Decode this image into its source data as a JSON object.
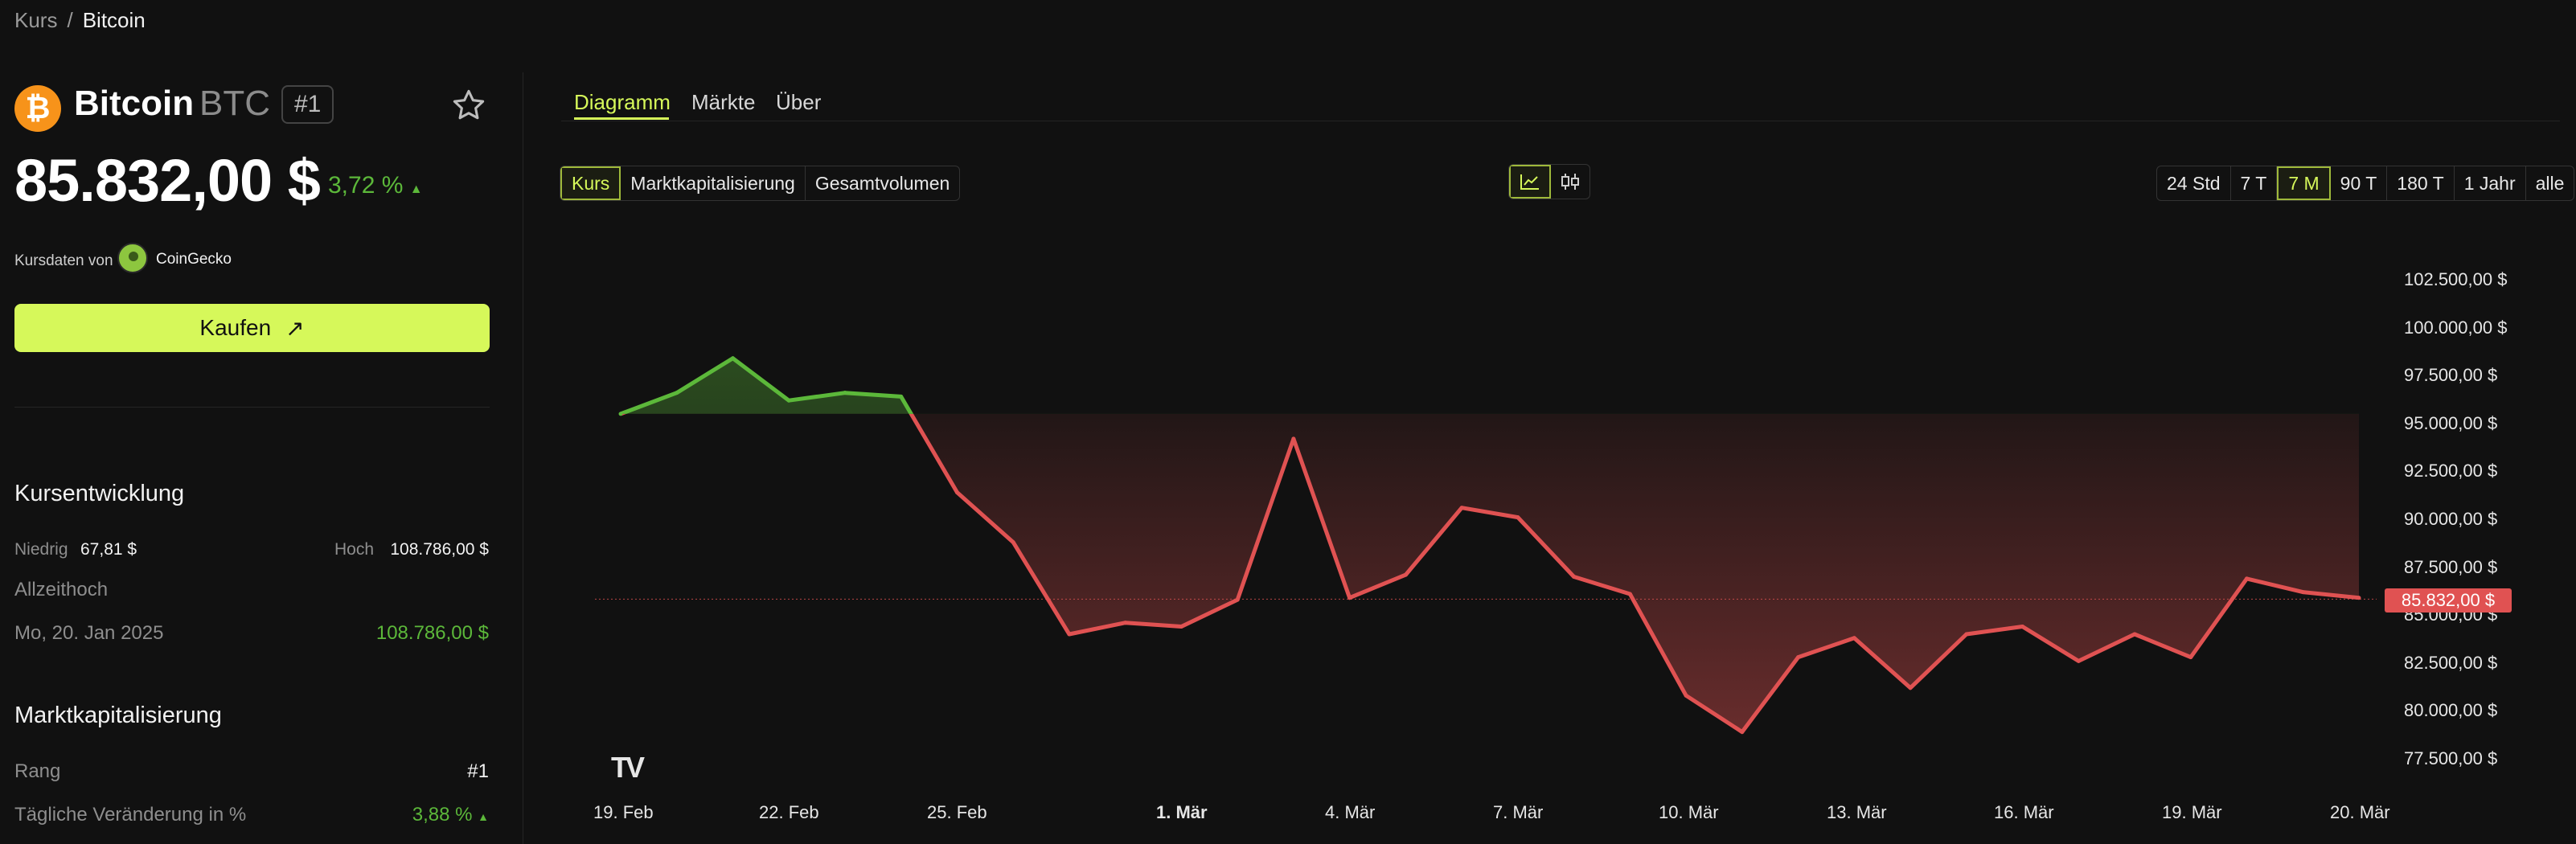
{
  "breadcrumb": {
    "parent": "Kurs",
    "separator": "/",
    "current": "Bitcoin"
  },
  "coin": {
    "name": "Bitcoin",
    "symbol": "BTC",
    "rank_badge": "#1",
    "price": "85.832,00 $",
    "change_24h": "3,72 %",
    "change_arrow": "▲",
    "source_label": "Kursdaten von",
    "source_name": "CoinGecko",
    "buy_label": "Kaufen",
    "buy_arrow": "↗"
  },
  "kursentwicklung": {
    "title": "Kursentwicklung",
    "low_label": "Niedrig",
    "low_value": "67,81 $",
    "high_label": "Hoch",
    "high_value": "108.786,00 $",
    "ath_label": "Allzeithoch",
    "ath_date": "Mo, 20. Jan 2025",
    "ath_value": "108.786,00 $"
  },
  "marktkap": {
    "title": "Marktkapitalisierung",
    "rank_label": "Rang",
    "rank_value": "#1",
    "daily_label": "Tägliche Veränderung in %",
    "daily_value": "3,88 %",
    "daily_arrow": "▲"
  },
  "tabs": [
    {
      "label": "Diagramm"
    },
    {
      "label": "Märkte"
    },
    {
      "label": "Über"
    }
  ],
  "metrics": [
    {
      "label": "Kurs"
    },
    {
      "label": "Marktkapitalisierung"
    },
    {
      "label": "Gesamtvolumen"
    }
  ],
  "chart_mode_icons": [
    "line-chart-icon",
    "candlestick-icon"
  ],
  "ranges": [
    {
      "label": "24 Std"
    },
    {
      "label": "7 T"
    },
    {
      "label": "7 M"
    },
    {
      "label": "90 T"
    },
    {
      "label": "180 T"
    },
    {
      "label": "1 Jahr"
    },
    {
      "label": "alle"
    }
  ],
  "colors": {
    "accent": "#d6f85a",
    "up": "#5cb83a",
    "down": "#e05252",
    "bg": "#111111"
  },
  "chart_data": {
    "type": "line",
    "xlabel": "",
    "ylabel": "",
    "x_ticks": [
      "19. Feb",
      "22. Feb",
      "25. Feb",
      "1. Mär",
      "4. Mär",
      "7. Mär",
      "10. Mär",
      "13. Mär",
      "16. Mär",
      "19. Mär",
      "20. Mär"
    ],
    "y_ticks": [
      "102.500,00 $",
      "100.000,00 $",
      "97.500,00 $",
      "95.000,00 $",
      "92.500,00 $",
      "90.000,00 $",
      "87.500,00 $",
      "85.000,00 $",
      "82.500,00 $",
      "80.000,00 $",
      "77.500,00 $"
    ],
    "ylim": [
      77500,
      102500
    ],
    "baseline": 95500,
    "current_price_label": "85.832,00 $",
    "current_price": 85832,
    "series": [
      {
        "values": [
          95500,
          96600,
          98400,
          96200,
          96600,
          96400,
          91400,
          88800,
          84000,
          84600,
          84400,
          85800,
          94200,
          85900,
          87100,
          90600,
          90100,
          87000,
          86100,
          80800,
          78900,
          82800,
          83800,
          81200,
          84000,
          84400,
          82600,
          84000,
          82800,
          86900,
          86200,
          85900
        ]
      }
    ]
  }
}
